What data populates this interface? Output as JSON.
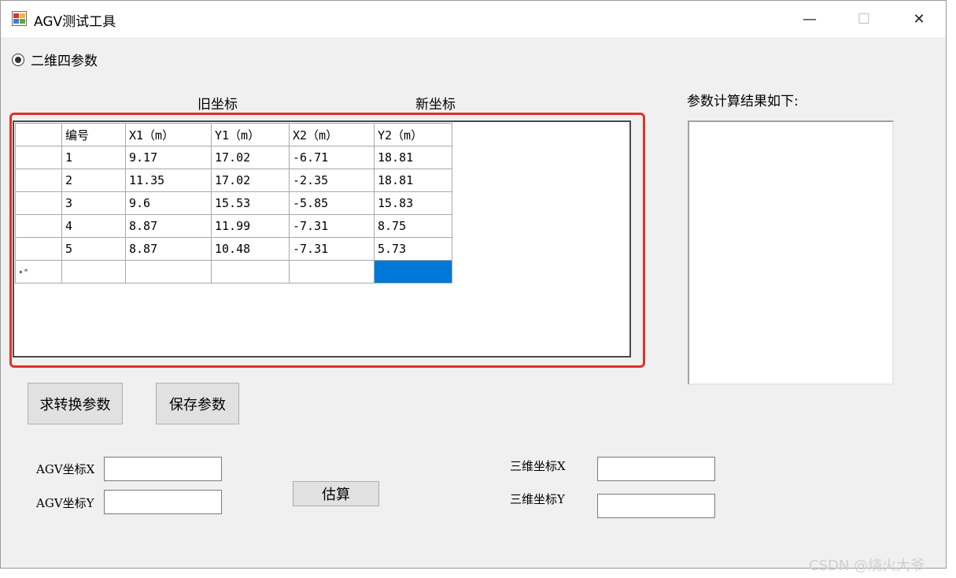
{
  "window": {
    "title": "AGV测试工具"
  },
  "title_controls": {
    "minimize": "—",
    "maximize": "☐",
    "close": "✕"
  },
  "mode_radio": {
    "label": "二维四参数",
    "checked": true
  },
  "labels": {
    "old_coords": "旧坐标",
    "new_coords": "新坐标",
    "result_title": "参数计算结果如下:"
  },
  "grid": {
    "columns": [
      "编号",
      "X1（m）",
      "Y1（m）",
      "X2（m）",
      "Y2（m）"
    ],
    "rows": [
      [
        "1",
        "9.17",
        "17.02",
        "-6.71",
        "18.81"
      ],
      [
        "2",
        "11.35",
        "17.02",
        "-2.35",
        "18.81"
      ],
      [
        "3",
        "9.6",
        "15.53",
        "-5.85",
        "15.83"
      ],
      [
        "4",
        "8.87",
        "11.99",
        "-7.31",
        "8.75"
      ],
      [
        "5",
        "8.87",
        "10.48",
        "-7.31",
        "5.73"
      ]
    ],
    "new_row_marker": "▸*",
    "selection_color": "#0078d7"
  },
  "buttons": {
    "compute": "求转换参数",
    "save": "保存参数",
    "estimate": "估算"
  },
  "fields": {
    "agv_x_label": "AGV坐标X",
    "agv_y_label": "AGV坐标Y",
    "agv_x_value": "",
    "agv_y_value": "",
    "coord3d_x_label": "三维坐标X",
    "coord3d_y_label": "三维坐标Y",
    "coord3d_x_value": "",
    "coord3d_y_value": ""
  },
  "watermark": "CSDN @烧火大爷",
  "colors": {
    "highlight_frame": "#e0302a"
  }
}
